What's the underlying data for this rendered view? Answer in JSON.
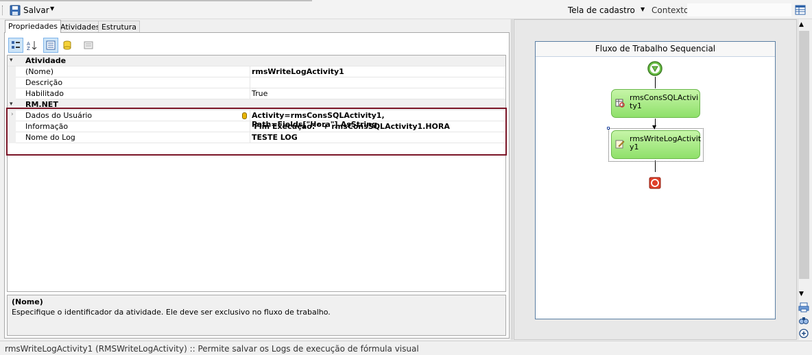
{
  "toolbar": {
    "save_label": "Salvar",
    "screen_select": "Tela de cadastro",
    "context_label": "Contexto:"
  },
  "tabs": [
    {
      "label": "Propriedades",
      "active": true
    },
    {
      "label": "Atividades",
      "active": false
    },
    {
      "label": "Estrutura",
      "active": false
    }
  ],
  "properties": {
    "categories": [
      {
        "name": "Atividade",
        "rows": [
          {
            "name": "(Nome)",
            "value": "rmsWriteLogActivity1",
            "bold": true
          },
          {
            "name": "Descrição",
            "value": "",
            "bold": false
          },
          {
            "name": "Habilitado",
            "value": "True",
            "bold": false
          }
        ]
      },
      {
        "name": "RM.NET",
        "rows": [
          {
            "name": "Dados do Usuário",
            "value": "Activity=rmsConsSQLActivity1, Path=Fields[\"Hora\"].AsString",
            "bold": true
          },
          {
            "name": "Informação",
            "value": "'Fim Execução: ' + rmsConsSQLActivity1.HORA",
            "bold": true
          },
          {
            "name": "Nome do Log",
            "value": "TESTE LOG",
            "bold": true
          }
        ]
      }
    ]
  },
  "description": {
    "title": "(Nome)",
    "text": "Especifique o identificador da atividade. Ele deve ser exclusivo no fluxo de trabalho."
  },
  "workflow": {
    "title": "Fluxo de Trabalho Sequencial",
    "activities": [
      {
        "label_line1": "rmsConsSQLActivi",
        "label_line2": "ty1",
        "icon": "sql-query-icon"
      },
      {
        "label_line1": "rmsWriteLogActivit",
        "label_line2": "y1",
        "icon": "write-log-icon"
      }
    ]
  },
  "status": {
    "text": "rmsWriteLogActivity1  (RMSWriteLogActivity)  :: Permite salvar os Logs de execução de fórmula visual"
  },
  "colors": {
    "highlight_border": "#7a1426",
    "activity_fill": "#a8ea84",
    "activity_border": "#6cb84d",
    "canvas_border": "#5a7ea3"
  }
}
